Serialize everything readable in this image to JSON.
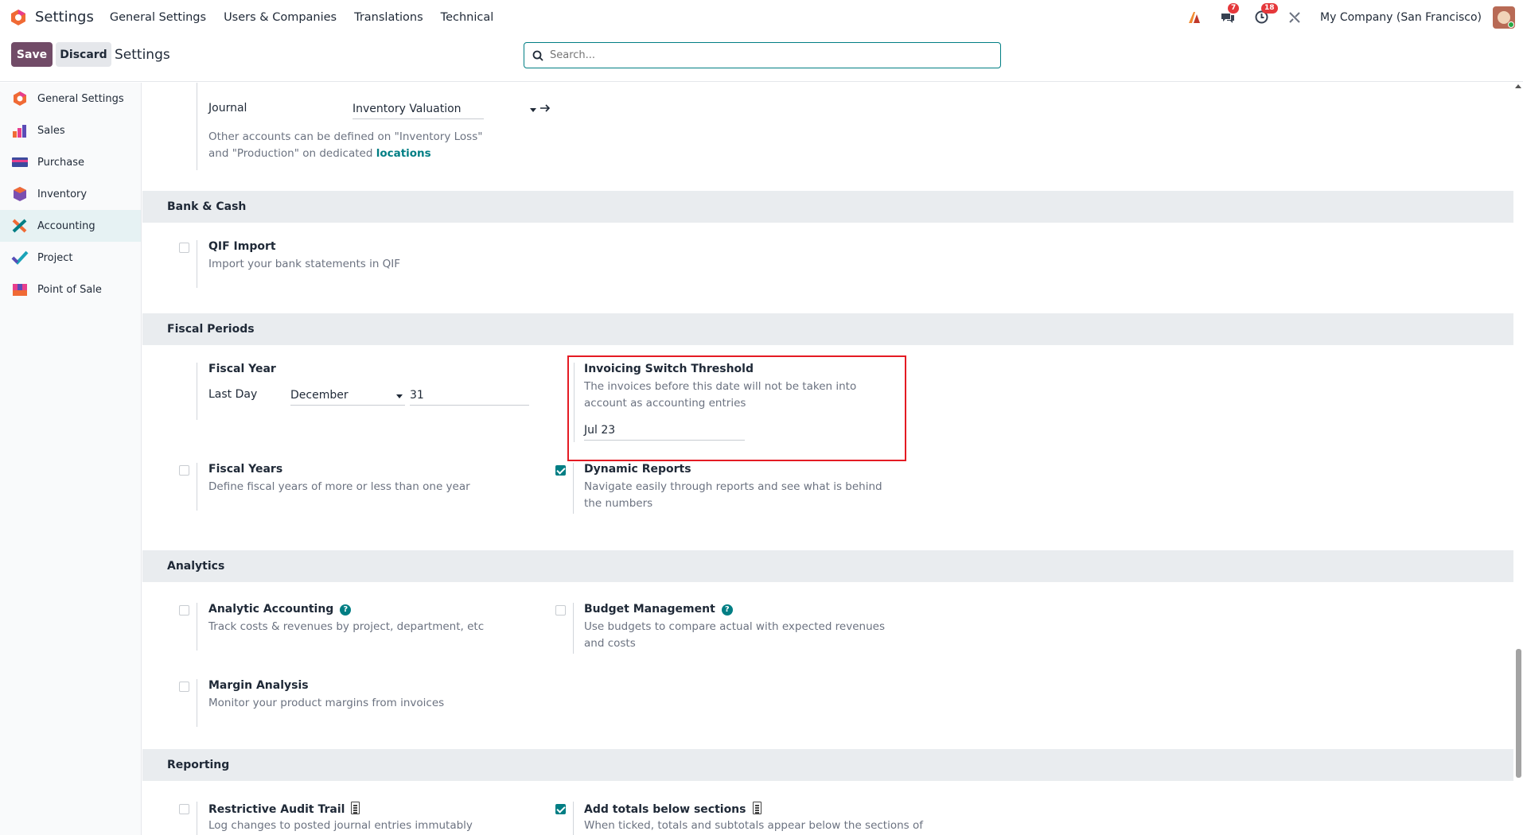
{
  "navbar": {
    "app_title": "Settings",
    "menu": [
      "General Settings",
      "Users & Companies",
      "Translations",
      "Technical"
    ],
    "chat_badge": "7",
    "activity_badge": "18",
    "company": "My Company (San Francisco)"
  },
  "control_panel": {
    "save_label": "Save",
    "discard_label": "Discard",
    "title": "Settings",
    "search_placeholder": "Search..."
  },
  "sidebar": {
    "items": [
      {
        "label": "General Settings",
        "icon": "odoo-logo-icon"
      },
      {
        "label": "Sales",
        "icon": "sales-chart-icon"
      },
      {
        "label": "Purchase",
        "icon": "purchase-card-icon"
      },
      {
        "label": "Inventory",
        "icon": "inventory-box-icon"
      },
      {
        "label": "Accounting",
        "icon": "accounting-icon",
        "active": true
      },
      {
        "label": "Project",
        "icon": "project-check-icon"
      },
      {
        "label": "Point of Sale",
        "icon": "pos-store-icon"
      }
    ]
  },
  "valuation": {
    "journal_label": "Journal",
    "journal_value": "Inventory Valuation",
    "note_text": "Other accounts can be defined on \"Inventory Loss\" and \"Production\" on dedicated ",
    "note_link": "locations"
  },
  "sections": {
    "bank_cash": "Bank & Cash",
    "fiscal_periods": "Fiscal Periods",
    "analytics": "Analytics",
    "reporting": "Reporting"
  },
  "settings": {
    "qif": {
      "title": "QIF Import",
      "desc": "Import your bank statements in QIF",
      "checked": false
    },
    "fiscal_year": {
      "title": "Fiscal Year",
      "last_day_label": "Last Day",
      "month": "December",
      "day": "31"
    },
    "invoicing_threshold": {
      "title": "Invoicing Switch Threshold",
      "desc": "The invoices before this date will not be taken into account as accounting entries",
      "value": "Jul 23"
    },
    "fiscal_years": {
      "title": "Fiscal Years",
      "desc": "Define fiscal years of more or less than one year",
      "checked": false
    },
    "dynamic_reports": {
      "title": "Dynamic Reports",
      "desc": "Navigate easily through reports and see what is behind the numbers",
      "checked": true
    },
    "analytic_accounting": {
      "title": "Analytic Accounting",
      "desc": "Track costs & revenues by project, department, etc",
      "checked": false
    },
    "budget_management": {
      "title": "Budget Management",
      "desc": "Use budgets to compare actual with expected revenues and costs",
      "checked": false
    },
    "margin_analysis": {
      "title": "Margin Analysis",
      "desc": "Monitor your product margins from invoices",
      "checked": false
    },
    "restrictive_audit": {
      "title": "Restrictive Audit Trail",
      "desc": "Log changes to posted journal entries immutably",
      "checked": false
    },
    "add_totals": {
      "title": "Add totals below sections",
      "desc": "When ticked, totals and subtotals appear below the sections of",
      "checked": true
    }
  },
  "colors": {
    "brand": "#714b67",
    "accent": "#017e84",
    "highlight_box": "#e41b23"
  }
}
